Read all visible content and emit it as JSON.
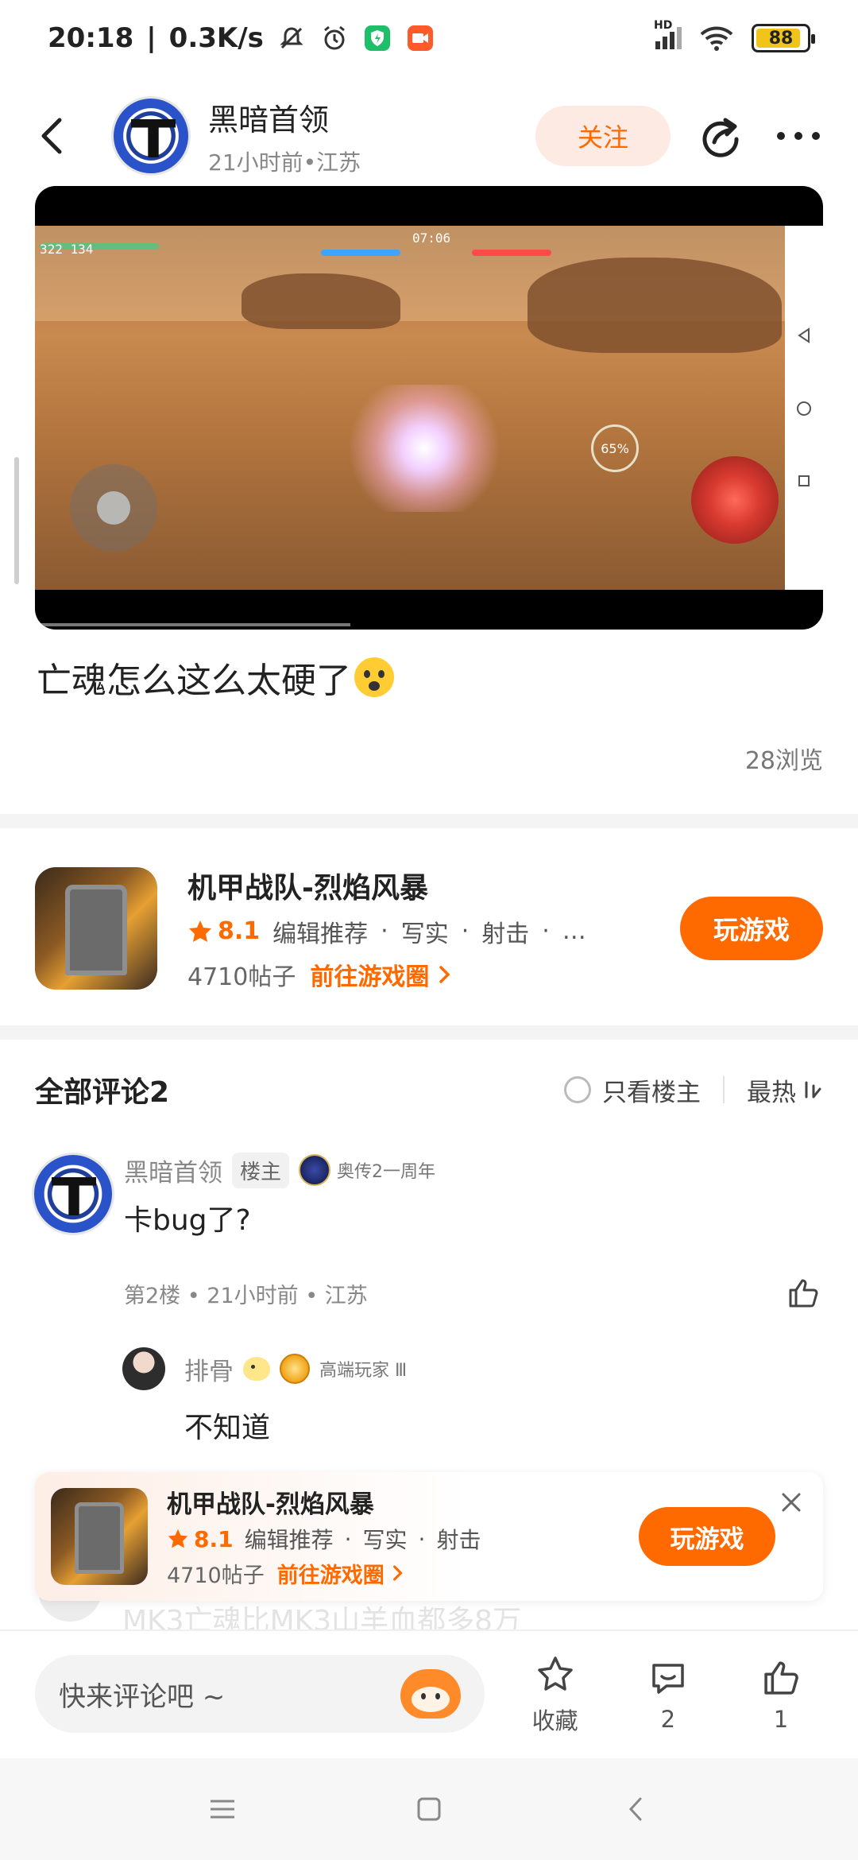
{
  "status": {
    "time": "20:18",
    "net_speed": "0.3K/s",
    "battery": "88",
    "battery_level": 0.88,
    "network_label": "HD"
  },
  "header": {
    "username": "黑暗首领",
    "subtitle": "21小时前•江苏",
    "follow_label": "关注"
  },
  "video": {
    "timer": "07:06",
    "score": "322 134",
    "ability_pct": "65%",
    "progress": 0.4
  },
  "post": {
    "title": "亡魂怎么这么太硬了",
    "views": "28浏览"
  },
  "game_card": {
    "name": "机甲战队-烈焰风暴",
    "rating": "8.1",
    "tag1": "编辑推荐",
    "tag2": "写实",
    "tag3": "射击",
    "more": "…",
    "posts": "4710帖子",
    "goto": "前往游戏圈",
    "play_label": "玩游戏"
  },
  "comments": {
    "title": "全部评论2",
    "only_op_label": "只看楼主",
    "sort_label": "最热",
    "items": [
      {
        "name": "黑暗首领",
        "op_badge": "楼主",
        "medal": "奥传2一周年",
        "text": "卡bug了?",
        "meta": "第2楼 • 21小时前 • 江苏"
      }
    ],
    "reply": {
      "name": "排骨",
      "medal": "高端玩家 Ⅲ",
      "text": "不知道"
    },
    "ghost_text": "MK3亡魂比MK3山羊血都多8万"
  },
  "float_banner": {
    "name": "机甲战队-烈焰风暴",
    "rating": "8.1",
    "tag1": "编辑推荐",
    "tag2": "写实",
    "tag3": "射击",
    "posts": "4710帖子",
    "goto": "前往游戏圈",
    "play_label": "玩游戏"
  },
  "bottom_bar": {
    "input_placeholder": "快来评论吧 ~",
    "favorite_label": "收藏",
    "comment_count": "2",
    "like_count": "1"
  },
  "colors": {
    "accent": "#ff6a00",
    "follow_bg": "#fdeae3"
  }
}
